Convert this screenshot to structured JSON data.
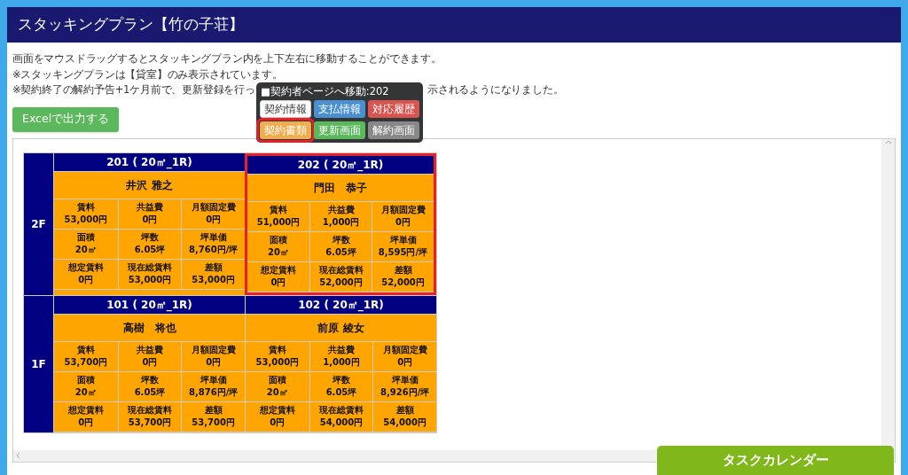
{
  "header": {
    "title": "スタッキングプラン【竹の子荘】"
  },
  "notes": [
    {
      "text": "画面をマウスドラッグするとスタッキングプラン内を上下左右に移動することができます。"
    },
    {
      "text": "※スタッキングプランは【貸室】のみ表示されています。"
    },
    {
      "text": "※契約終了の解約予告+1ケ月前で、更新登録を行っ",
      "text_after_popup": "示されるようになりました。"
    }
  ],
  "export_button": "Excelで出力する",
  "popup": {
    "title": "■契約者ページへ移動:202",
    "buttons": [
      {
        "label": "契約情報",
        "kind": "white",
        "highlighted": false
      },
      {
        "label": "支払情報",
        "kind": "blue",
        "highlighted": false
      },
      {
        "label": "対応履歴",
        "kind": "red",
        "highlighted": false
      },
      {
        "label": "契約書類",
        "kind": "orange",
        "highlighted": true
      },
      {
        "label": "更新画面",
        "kind": "green",
        "highlighted": false
      },
      {
        "label": "解約画面",
        "kind": "gray",
        "highlighted": false
      }
    ]
  },
  "floors": [
    {
      "label": "2F",
      "units": [
        {
          "room": "201 ( 20㎡_1R)",
          "tenant": "井沢 雅之",
          "highlighted": false,
          "fields": [
            {
              "label": "賃料",
              "value": "53,000円"
            },
            {
              "label": "共益費",
              "value": "0円"
            },
            {
              "label": "月額固定費",
              "value": "0円"
            },
            {
              "label": "面積",
              "value": "20㎡"
            },
            {
              "label": "坪数",
              "value": "6.05坪"
            },
            {
              "label": "坪単価",
              "value": "8,760円/坪"
            },
            {
              "label": "想定賃料",
              "value": "0円"
            },
            {
              "label": "現在総賃料",
              "value": "53,000円"
            },
            {
              "label": "差額",
              "value": "53,000円"
            }
          ]
        },
        {
          "room": "202 ( 20㎡_1R)",
          "tenant": "門田　恭子",
          "highlighted": true,
          "fields": [
            {
              "label": "賃料",
              "value": "51,000円"
            },
            {
              "label": "共益費",
              "value": "1,000円"
            },
            {
              "label": "月額固定費",
              "value": "0円"
            },
            {
              "label": "面積",
              "value": "20㎡"
            },
            {
              "label": "坪数",
              "value": "6.05坪"
            },
            {
              "label": "坪単価",
              "value": "8,595円/坪"
            },
            {
              "label": "想定賃料",
              "value": "0円"
            },
            {
              "label": "現在総賃料",
              "value": "52,000円"
            },
            {
              "label": "差額",
              "value": "52,000円"
            }
          ]
        }
      ]
    },
    {
      "label": "1F",
      "units": [
        {
          "room": "101 ( 20㎡_1R)",
          "tenant": "高樹　将也",
          "highlighted": false,
          "fields": [
            {
              "label": "賃料",
              "value": "53,700円"
            },
            {
              "label": "共益費",
              "value": "0円"
            },
            {
              "label": "月額固定費",
              "value": "0円"
            },
            {
              "label": "面積",
              "value": "20㎡"
            },
            {
              "label": "坪数",
              "value": "6.05坪"
            },
            {
              "label": "坪単価",
              "value": "8,876円/坪"
            },
            {
              "label": "想定賃料",
              "value": "0円"
            },
            {
              "label": "現在総賃料",
              "value": "53,700円"
            },
            {
              "label": "差額",
              "value": "53,700円"
            }
          ]
        },
        {
          "room": "102 ( 20㎡_1R)",
          "tenant": "前原 綾女",
          "highlighted": false,
          "fields": [
            {
              "label": "賃料",
              "value": "53,000円"
            },
            {
              "label": "共益費",
              "value": "1,000円"
            },
            {
              "label": "月額固定費",
              "value": "0円"
            },
            {
              "label": "面積",
              "value": "20㎡"
            },
            {
              "label": "坪数",
              "value": "6.05坪"
            },
            {
              "label": "坪単価",
              "value": "8,926円/坪"
            },
            {
              "label": "想定賃料",
              "value": "0円"
            },
            {
              "label": "現在総賃料",
              "value": "54,000円"
            },
            {
              "label": "差額",
              "value": "54,000円"
            }
          ]
        }
      ]
    }
  ],
  "task_calendar_button": "タスクカレンダー"
}
